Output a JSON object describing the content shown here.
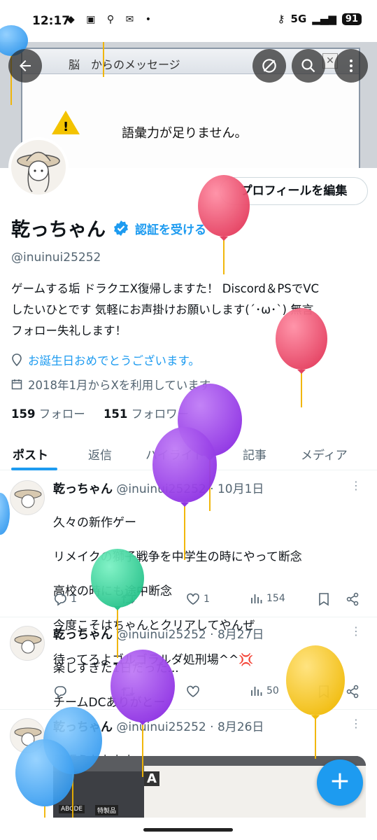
{
  "status_bar": {
    "time": "12:17",
    "network": "5G",
    "battery": "91"
  },
  "banner": {
    "dialog_title": "脳　からのメッセージ",
    "dialog_message": "語彙力が足りません。"
  },
  "profile": {
    "edit_button": "プロフィールを編集",
    "name": "乾っちゃん",
    "get_verified": "認証を受ける",
    "handle": "@inuinui25252",
    "bio_line1": "ゲームする垢 ドラクエX復帰しますた！ Discord＆PSでVC",
    "bio_line2": "したいひとです 気軽にお声掛けお願いします(´･ω･`) 無言",
    "bio_line3": "フォロー失礼します！",
    "birthday": "お誕生日おめでとうございます。",
    "joined": "2018年1月からXを利用しています",
    "following_count": "159",
    "following_label": "フォロー",
    "followers_count": "151",
    "followers_label": "フォロワー"
  },
  "tabs": [
    {
      "label": "ポスト",
      "active": true
    },
    {
      "label": "返信",
      "active": false
    },
    {
      "label": "ハイライト",
      "active": false
    },
    {
      "label": "記事",
      "active": false
    },
    {
      "label": "メディア",
      "active": false
    }
  ],
  "posts": [
    {
      "name": "乾っちゃん",
      "handle": "@inuinui25252",
      "date": "· 10月1日",
      "lines": [
        "久々の新作ゲー",
        "リメイクの獅子戦争を中学生の時にやって断念",
        "高校の時にも途中断念",
        "今度こそはちゃんとクリアしてやんぜ",
        "待ってろよゴルゴラルダ処刑場^^💢"
      ],
      "replies": "1",
      "likes": "1",
      "views": "154"
    },
    {
      "name": "乾っちゃん",
      "handle": "@inuinui25252",
      "date": "· 8月27日",
      "lines": [
        "楽しすぎた1日だった...",
        "チームDCありがとー"
      ],
      "views": "50"
    },
    {
      "name": "乾っちゃん",
      "handle": "@inuinui25252",
      "date": "· 8月26日",
      "lines": [
        "幕張うおおおお"
      ],
      "media_letters": [
        "A",
        "ABCDE",
        "特製品"
      ]
    }
  ],
  "colors": {
    "accent": "#1d9bf0",
    "balloon_red": "#f0506e",
    "balloon_purple": "#9b3be8",
    "balloon_green": "#2fd69a",
    "balloon_yellow": "#f5c518",
    "balloon_blue": "#3aa7f5"
  },
  "icons": [
    "back-arrow-icon",
    "no-notifications-icon",
    "search-icon",
    "more-icon",
    "verified-badge-icon",
    "location-icon",
    "calendar-icon",
    "reply-icon",
    "retweet-icon",
    "like-icon",
    "views-icon",
    "bookmark-icon",
    "share-icon",
    "compose-icon"
  ]
}
